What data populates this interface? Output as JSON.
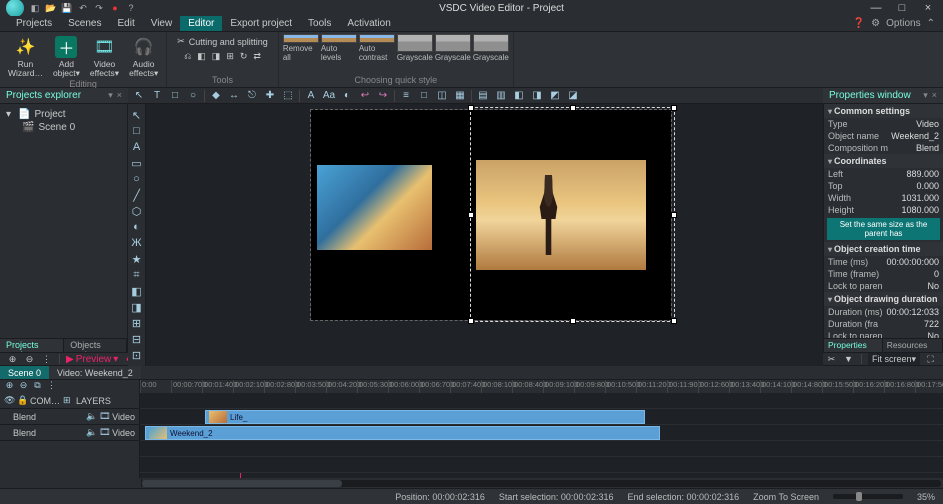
{
  "app": {
    "title": "VSDC Video Editor - Project"
  },
  "qa_icons": [
    "new",
    "open",
    "save",
    "undo",
    "redo",
    "rec",
    "help"
  ],
  "win": {
    "min": "—",
    "max": "□",
    "close": "×"
  },
  "menubar": {
    "items": [
      "Projects",
      "Scenes",
      "Edit",
      "View",
      "Editor",
      "Export project",
      "Tools",
      "Activation"
    ],
    "active": 4,
    "options": "Options"
  },
  "ribbon": {
    "group1": {
      "title": "Editing",
      "items": [
        {
          "icon": "✎",
          "label": "Run\nWizard…"
        },
        {
          "icon": "＋",
          "label": "Add\nobject▾",
          "bg": "#0a6"
        },
        {
          "icon": "▦",
          "label": "Video\neffects▾"
        },
        {
          "icon": "🎧",
          "label": "Audio\neffects▾"
        }
      ]
    },
    "tools": {
      "title": "Tools",
      "cutting": "Cutting and splitting"
    },
    "styles": {
      "title": "Choosing quick style",
      "items": [
        {
          "label": "Remove all"
        },
        {
          "label": "Auto levels"
        },
        {
          "label": "Auto contrast"
        },
        {
          "label": "Grayscale",
          "gray": true
        },
        {
          "label": "Grayscale",
          "gray": true
        },
        {
          "label": "Grayscale",
          "gray": true
        }
      ]
    }
  },
  "explorer": {
    "title": "Projects explorer",
    "project": "Project",
    "scene": "Scene 0",
    "tabs": [
      "Projects explorer",
      "Objects explorer"
    ]
  },
  "center_tb_icons": [
    "↖",
    "T",
    "□",
    "○",
    "◆",
    "↔",
    "⎋",
    "✚",
    "⬚",
    "A",
    "Aa",
    "◐",
    "↩",
    "↪",
    "≡",
    "□",
    "◫",
    "▦",
    "▤",
    "▥",
    "◧",
    "◨",
    "◩",
    "◪"
  ],
  "left_tools": [
    "↖",
    "□",
    "A",
    "▭",
    "○",
    "╱",
    "⬡",
    "◐",
    "Ж",
    "★",
    "⌗",
    "◧",
    "◨",
    "⊞",
    "⊟",
    "⊡"
  ],
  "props": {
    "title": "Properties window",
    "sections": {
      "common": "Common settings",
      "coords": "Coordinates",
      "create": "Object creation time",
      "dur": "Object drawing duration"
    },
    "rows": {
      "type_k": "Type",
      "type_v": "Video",
      "name_k": "Object name",
      "name_v": "Weekend_2",
      "comp_k": "Composition m",
      "comp_v": "Blend",
      "left_k": "Left",
      "left_v": "889.000",
      "top_k": "Top",
      "top_v": "0.000",
      "width_k": "Width",
      "width_v": "1031.000",
      "height_k": "Height",
      "height_v": "1080.000",
      "btn": "Set the same size as the parent has",
      "time_k": "Time (ms)",
      "time_v": "00:00:00:000",
      "frame_k": "Time (frame)",
      "frame_v": "0",
      "lock_k": "Lock to paren",
      "lock_v": "No",
      "durms_k": "Duration (ms)",
      "durms_v": "00:00:12:033",
      "durfr_k": "Duration (fra",
      "durfr_v": "722",
      "lock2_k": "Lock to paren",
      "lock2_v": "No"
    },
    "tabs": [
      "Properties win…",
      "Resources win…"
    ]
  },
  "transport": {
    "preview": "Preview",
    "fit": "Fit screen"
  },
  "scene_row": {
    "tabs": [
      "Scene 0",
      "Video: Weekend_2"
    ]
  },
  "timeline": {
    "ticks": [
      "0:00",
      "00:00:700",
      "00:01:400",
      "00:02:100",
      "00:02:800",
      "00:03:500",
      "00:04:200",
      "00:05:300",
      "00:06:000",
      "00:06:700",
      "00:07:400",
      "00:08:100",
      "00:08:400",
      "00:09:100",
      "00:09:800",
      "00:10:500",
      "00:11:200",
      "00:11:900",
      "00:12:600",
      "00:13:400",
      "00:14:100",
      "00:14:800",
      "00:15:500",
      "00:16:200",
      "00:16:800",
      "00:17:500"
    ],
    "header_row": {
      "com": "COM…",
      "layers": "LAYERS"
    },
    "tracks": [
      {
        "mode": "Blend",
        "type": "Video",
        "clip": "Life_",
        "start": 65,
        "len": 440
      },
      {
        "mode": "Blend",
        "type": "Video",
        "clip": "Weekend_2",
        "start": 5,
        "len": 515
      }
    ]
  },
  "status": {
    "pos_k": "Position:",
    "pos_v": "00:00:02:316",
    "ss_k": "Start selection:",
    "ss_v": "00:00:02:316",
    "es_k": "End selection:",
    "es_v": "00:00:02:316",
    "zoom_k": "Zoom To Screen",
    "zoom_v": "35%"
  }
}
